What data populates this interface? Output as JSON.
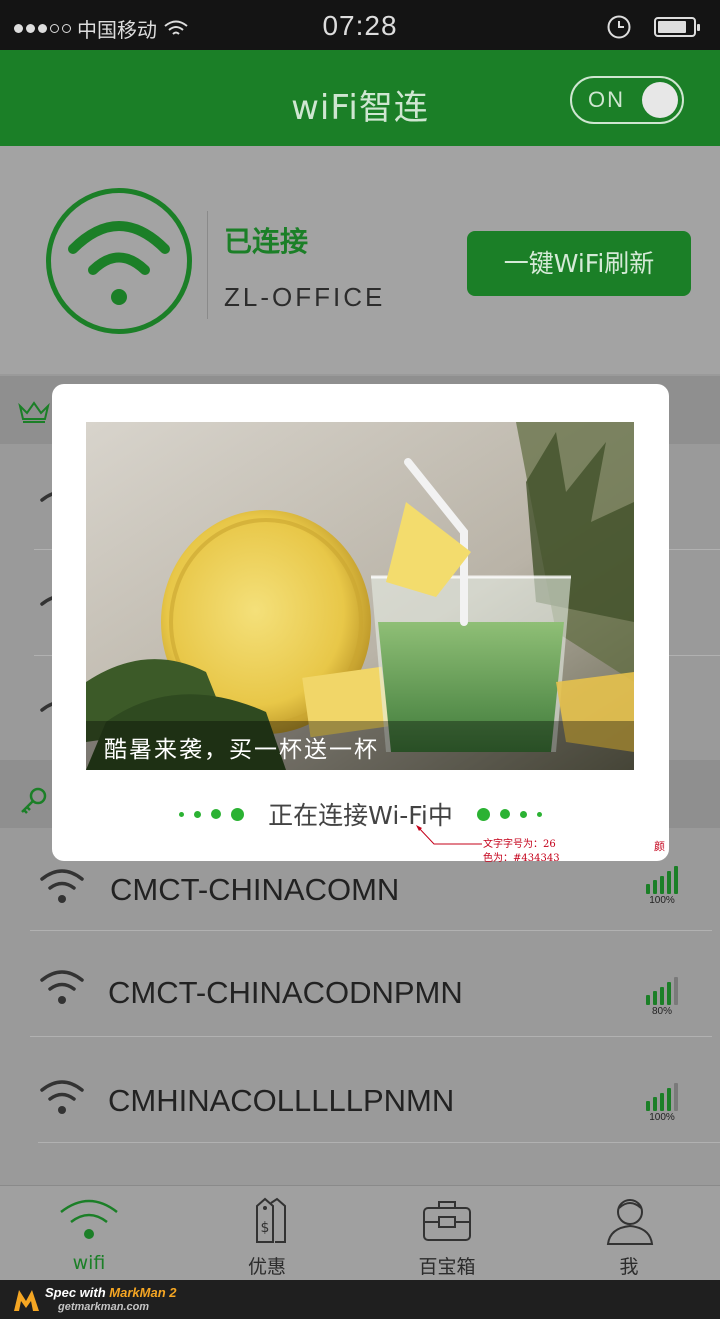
{
  "status_bar": {
    "carrier": "中国移动",
    "time": "07:28"
  },
  "header": {
    "title": "wiFi智连",
    "toggle_label": "ON"
  },
  "connected": {
    "status": "已连接",
    "ssid": "ZL-OFFICE",
    "refresh_button": "一键WiFi刷新"
  },
  "networks": [
    {
      "ssid": "CMCT-CHINACOMN",
      "signal_bars": 5,
      "signal_pct": "100%"
    },
    {
      "ssid": "CMCT-CHINACODNPMN",
      "signal_bars": 4,
      "signal_pct": "80%"
    },
    {
      "ssid": "CMHINACOLLLLLPNMN",
      "signal_bars": 4,
      "signal_pct": "100%"
    }
  ],
  "modal": {
    "ad_caption": "酷暑来袭，买一杯送一杯",
    "connecting_text": "正在连接Wi-Fi中"
  },
  "annotation": {
    "line1": "文字字号为：26",
    "line2": "色为：#434343",
    "side": "颜"
  },
  "tabs": [
    {
      "label": "wifi",
      "icon": "wifi-icon",
      "active": true
    },
    {
      "label": "优惠",
      "icon": "price-tag-icon",
      "active": false
    },
    {
      "label": "百宝箱",
      "icon": "toolbox-icon",
      "active": false
    },
    {
      "label": "我",
      "icon": "user-icon",
      "active": false
    }
  ],
  "footer": {
    "line1_prefix": "Spec with ",
    "line1_brand": "MarkMan 2",
    "line2": "getmarkman.com"
  },
  "colors": {
    "brand_green": "#1b7f27",
    "dot_green": "#2bb233",
    "text": "#434343",
    "annotation_red": "#c4001a"
  }
}
